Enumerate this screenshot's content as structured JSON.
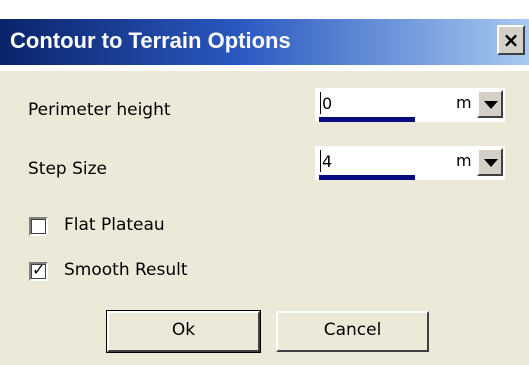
{
  "dialog": {
    "title": "Contour to Terrain Options",
    "close_label": "×"
  },
  "fields": [
    {
      "label": "Perimeter height",
      "value": "0",
      "unit": "m"
    },
    {
      "label": "Step Size",
      "value": "4",
      "unit": "m"
    }
  ],
  "options": [
    {
      "label": "Flat Plateau",
      "checked": false,
      "mark": ""
    },
    {
      "label": "Smooth Result",
      "checked": true,
      "mark": "✓"
    }
  ],
  "buttons": {
    "ok_label": "Ok",
    "cancel_label": "Cancel"
  },
  "colors": {
    "title_bar": "#0a246a",
    "dialog_bg": "#ece9d8",
    "field_underline": "#0a0a80"
  },
  "icons": {
    "close": "close-icon",
    "dropdown": "chevron-down-icon",
    "check": "checkmark-icon"
  }
}
